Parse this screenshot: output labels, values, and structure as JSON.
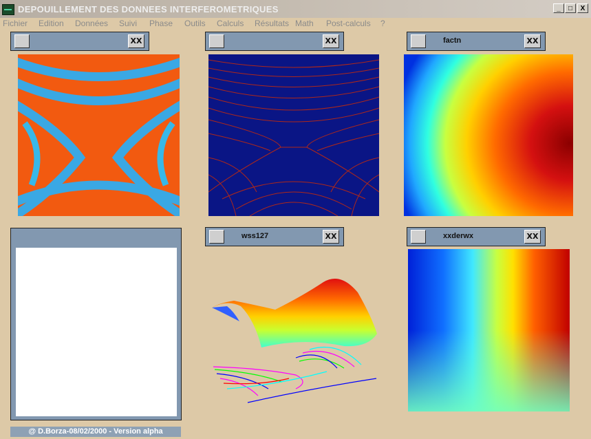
{
  "window": {
    "title": "DEPOUILLEMENT DES DONNEES INTERFEROMETRIQUES",
    "controls": {
      "minimize": "_",
      "maximize": "□",
      "close": "X"
    }
  },
  "menu": [
    "Fichier",
    "Edition",
    "Données",
    "Suivi",
    "Phase",
    "Outils",
    "Calculs",
    "Résultats",
    "Math",
    "Post-calculs",
    "?"
  ],
  "panels": {
    "p1": {
      "label": "",
      "close": "XX"
    },
    "p2": {
      "label": "",
      "close": "XX"
    },
    "p3": {
      "label": "factn",
      "close": "XX"
    },
    "p5": {
      "label": "wss127",
      "close": "XX"
    },
    "p6": {
      "label": "xxderwx",
      "close": "XX"
    }
  },
  "status": {
    "text": "@ D.Borza-08/02/2000 - Version alpha"
  }
}
